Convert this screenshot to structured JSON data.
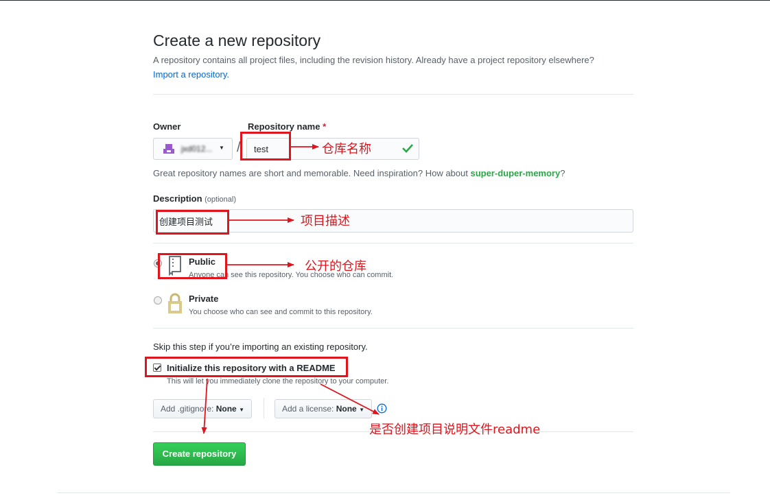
{
  "header": {
    "title": "Create a new repository",
    "subtitle": "A repository contains all project files, including the revision history. Already have a project repository elsewhere?",
    "import_link": "Import a repository."
  },
  "form": {
    "owner_label": "Owner",
    "owner_name": "jxd012...",
    "repo_label": "Repository name",
    "required_mark": "*",
    "repo_value": "test",
    "slash": "/",
    "hint_prefix": "Great repository names are short and memorable. Need inspiration? How about ",
    "hint_suggestion": "super-duper-memory",
    "hint_suffix": "?",
    "description_label": "Description",
    "description_optional": "(optional)",
    "description_value": "创建项目测试",
    "visibility": {
      "public_title": "Public",
      "public_note": "Anyone can see this repository. You choose who can commit.",
      "private_title": "Private",
      "private_note": "You choose who can see and commit to this repository.",
      "selected": "public"
    },
    "skip_note": "Skip this step if you’re importing an existing repository.",
    "init_title": "Initialize this repository with a README",
    "init_note": "This will let you immediately clone the repository to your computer.",
    "init_checked": true,
    "gitignore_prefix": "Add .gitignore:",
    "gitignore_value": "None",
    "license_prefix": "Add a license:",
    "license_value": "None",
    "submit_label": "Create repository"
  },
  "annotations": {
    "repo_name": "仓库名称",
    "description": "项目描述",
    "public": "公开的仓库",
    "readme": "是否创建项目说明文件readme"
  },
  "colors": {
    "accent_green": "#28a745",
    "link_blue": "#0366d6",
    "annotation_red": "#e0141c"
  }
}
